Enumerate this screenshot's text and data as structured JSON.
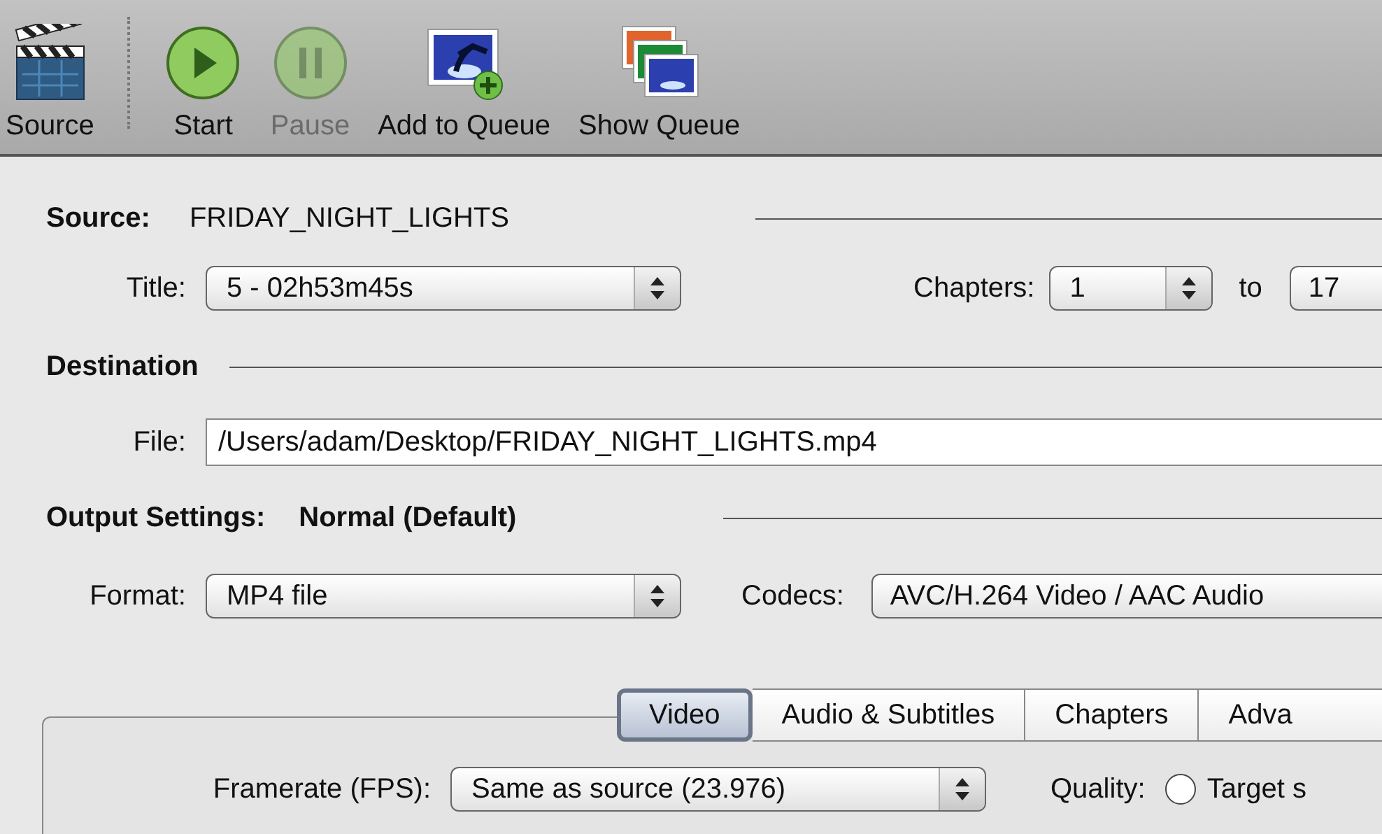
{
  "toolbar": {
    "items": [
      {
        "label": "Source",
        "kind": "clapper",
        "disabled": false
      },
      {
        "label": "Start",
        "kind": "start",
        "disabled": false
      },
      {
        "label": "Pause",
        "kind": "pause",
        "disabled": true
      },
      {
        "label": "Add to Queue",
        "kind": "add",
        "disabled": false
      },
      {
        "label": "Show Queue",
        "kind": "queue",
        "disabled": false
      }
    ]
  },
  "source": {
    "label": "Source:",
    "value": "FRIDAY_NIGHT_LIGHTS",
    "title_label": "Title:",
    "title_value": "5 - 02h53m45s",
    "chapters_label": "Chapters:",
    "chapter_start": "1",
    "to_label": "to",
    "chapter_end": "17"
  },
  "destination": {
    "heading": "Destination",
    "file_label": "File:",
    "file_value": "/Users/adam/Desktop/FRIDAY_NIGHT_LIGHTS.mp4"
  },
  "output": {
    "heading": "Output Settings:",
    "preset": "Normal (Default)",
    "format_label": "Format:",
    "format_value": "MP4 file",
    "codecs_label": "Codecs:",
    "codecs_value": "AVC/H.264 Video / AAC Audio"
  },
  "tabs": [
    {
      "label": "Video",
      "selected": true
    },
    {
      "label": "Audio & Subtitles",
      "selected": false
    },
    {
      "label": "Chapters",
      "selected": false
    },
    {
      "label": "Adva",
      "selected": false
    }
  ],
  "video": {
    "framerate_label": "Framerate (FPS):",
    "framerate_value": "Same as source (23.976)",
    "quality_label": "Quality:",
    "target_label": "Target s",
    "target_checked": false
  }
}
